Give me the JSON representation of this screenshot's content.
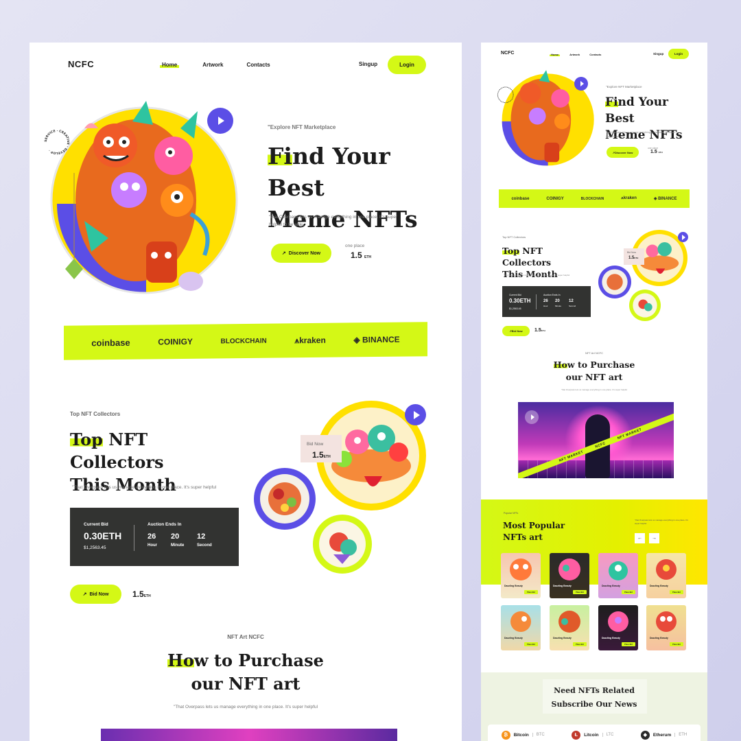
{
  "desktop": {
    "logo": "NCFC",
    "nav": [
      "Home",
      "Artwork",
      "Contacts"
    ],
    "signup": "Singup",
    "login": "Login",
    "hero": {
      "eyebrow": "\"Explore NFT Marketplace",
      "title_hl": "Fi",
      "title_rest1": "nd Your Best",
      "title_line2": "Meme NFTs",
      "desc": "\"that Overpass lets us manage everything in one place. It's super helpful to be able.",
      "cta": "Discover Now",
      "stat_label": "one place",
      "stat_value": "1.5",
      "stat_unit": "ETH",
      "badge_text": "SERVICE · CREATIVE · DEVELOP ·"
    },
    "brands": [
      "coinbase",
      "COINIGY",
      "BLOCKCHAIN",
      "kraken",
      "BINANCE"
    ],
    "collectors": {
      "eyebrow": "Top NFT Collectors",
      "title_hl": "Top",
      "title_rest1": " NFT Collectors",
      "title_line2": "This Month",
      "desc": "\"That Overpass lets us manage everything in one place. It's super helpful",
      "current_bid_label": "Current Bid",
      "current_bid": "0.30ETH",
      "current_bid_usd": "$1,2563.45",
      "auction_label": "Auction Ends In",
      "countdown": [
        {
          "n": "26",
          "u": "Hour"
        },
        {
          "n": "20",
          "u": "Minute"
        },
        {
          "n": "12",
          "u": "Second"
        }
      ],
      "bid_button": "Bid Now",
      "bid_value": "1.5",
      "bid_unit": "ETH",
      "tag_label": "Bid Now",
      "tag_value": "1.5",
      "tag_unit": "ETH"
    },
    "purchase": {
      "eyebrow": "NFT Art NCFC",
      "title_hl": "Ho",
      "title_rest1": "w to Purchase",
      "title_line2": "our NFT art",
      "desc": "\"That Overpass lets us manage everything in one place. It's super helpful"
    }
  },
  "mobile": {
    "logo": "NCFC",
    "nav": [
      "Home",
      "Artwork",
      "Contacts"
    ],
    "signup": "Singup",
    "login": "Login",
    "hero": {
      "eyebrow": "\"Explore NFT Marketplace",
      "title_hl": "Fi",
      "title_rest1": "nd Your Best",
      "title_line2": "Meme NFTs",
      "desc": "\"that Overpass lets us manage everything in one place. It's super helpful to be able.",
      "cta": "Discover Now",
      "stat_label": "one place",
      "stat_value": "1.5",
      "stat_unit": "ETH"
    },
    "brands": [
      "coinbase",
      "COINIGY",
      "BLOCKCHAIN",
      "kraken",
      "BINANCE"
    ],
    "collectors": {
      "eyebrow": "Top NFT Collectors",
      "title_hl": "Top",
      "title_rest1": " NFT Collectors",
      "title_line2": "This Month",
      "desc": "\"that Overpass lets us manage everything in one place. It's super helpful",
      "current_bid_label": "Current Bid",
      "current_bid": "0.30ETH",
      "current_bid_usd": "$1,2563.45",
      "auction_label": "Auction Ends In",
      "countdown": [
        {
          "n": "26",
          "u": "Hour"
        },
        {
          "n": "20",
          "u": "Minute"
        },
        {
          "n": "12",
          "u": "Second"
        }
      ],
      "bid_button": "Bid Now",
      "bid_value": "1.5",
      "bid_unit": "ETH",
      "tag_label": "Bid Now",
      "tag_value": "1.5",
      "tag_unit": "ETH"
    },
    "purchase": {
      "eyebrow": "NFT Art NCFC",
      "title_hl": "Ho",
      "title_rest1": "w to Purchase",
      "title_line2": "our NFT art",
      "desc": "\"that Overpass lets us manage everything in one place. It's super helpful",
      "video_band_1": "NFT MARKET",
      "video_band_2": "NCFC",
      "video_band_3": "NFT MARKET"
    },
    "popular": {
      "eyebrow": "Popular NFTs",
      "title": "Most Popular NFTs art",
      "desc": "\"that Overpass lets us manage everything in one place. It's super helpful",
      "prev": "←",
      "next": "→",
      "cards": [
        {
          "name": "Dazzling Beauty",
          "btn": "Place Bid"
        },
        {
          "name": "Dazzling Beauty",
          "btn": "Place Bid"
        },
        {
          "name": "Dazzling Beauty",
          "btn": "Place Bid"
        },
        {
          "name": "Dazzling Beauty",
          "btn": "Place Bid"
        },
        {
          "name": "Dazzling Beauty",
          "btn": "Place Bid"
        },
        {
          "name": "Dazzling Beauty",
          "btn": "Place Bid"
        },
        {
          "name": "Dazzling Beauty",
          "btn": "Place Bid"
        },
        {
          "name": "Dazzling Beauty",
          "btn": "Place Bid"
        }
      ]
    },
    "news": {
      "title_line1": "Need NFTs Related",
      "title_line2": "Subscribe Our News",
      "coins": [
        {
          "name": "Bitcoin",
          "sym": "BTC",
          "color": "#f7931a",
          "icon": "₿"
        },
        {
          "name": "Litcoin",
          "sym": "LTC",
          "color": "#c0392b",
          "icon": "Ł"
        },
        {
          "name": "Etherum",
          "sym": "ETH",
          "color": "#2a2a2a",
          "icon": "◆"
        }
      ]
    }
  },
  "colors": {
    "accent": "#d4f816",
    "purple": "#5b4ee6",
    "yellow": "#ffe000",
    "dark": "#323331"
  }
}
